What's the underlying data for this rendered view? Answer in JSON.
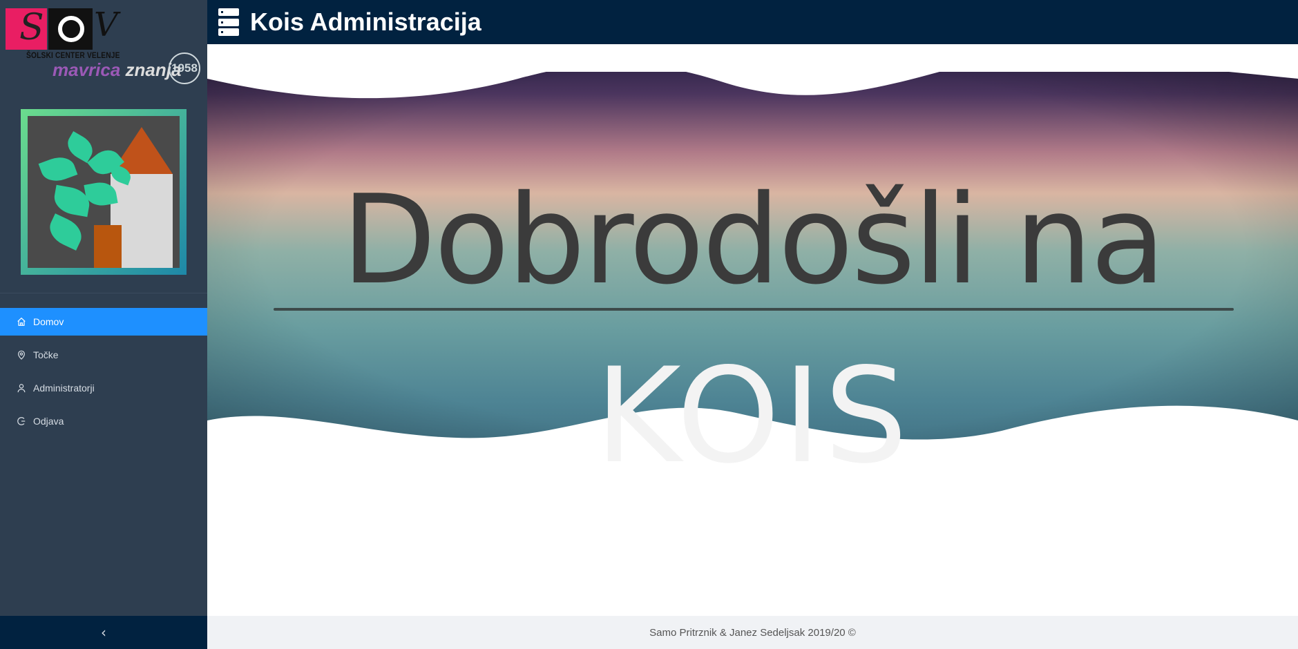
{
  "logo": {
    "school": "ŠOLSKI CENTER VELENJE",
    "tagline_1": "mavrica",
    "tagline_2": "znanja",
    "seal": "1958"
  },
  "header": {
    "title": "Kois Administracija"
  },
  "nav": {
    "items": [
      {
        "label": "Domov",
        "icon": "home-icon",
        "active": true
      },
      {
        "label": "Točke",
        "icon": "location-pin-icon",
        "active": false
      },
      {
        "label": "Administratorji",
        "icon": "user-icon",
        "active": false
      },
      {
        "label": "Odjava",
        "icon": "logout-icon",
        "active": false
      }
    ],
    "collapse": "‹"
  },
  "banner": {
    "line1": "Dobrodošli na",
    "line2": "KOIS"
  },
  "footer": {
    "text": "Samo Pritrznik & Janez Sedeljsak 2019/20 ©"
  },
  "colors": {
    "sidebar": "#2e3e50",
    "header": "#012240",
    "active": "#1e90ff"
  }
}
